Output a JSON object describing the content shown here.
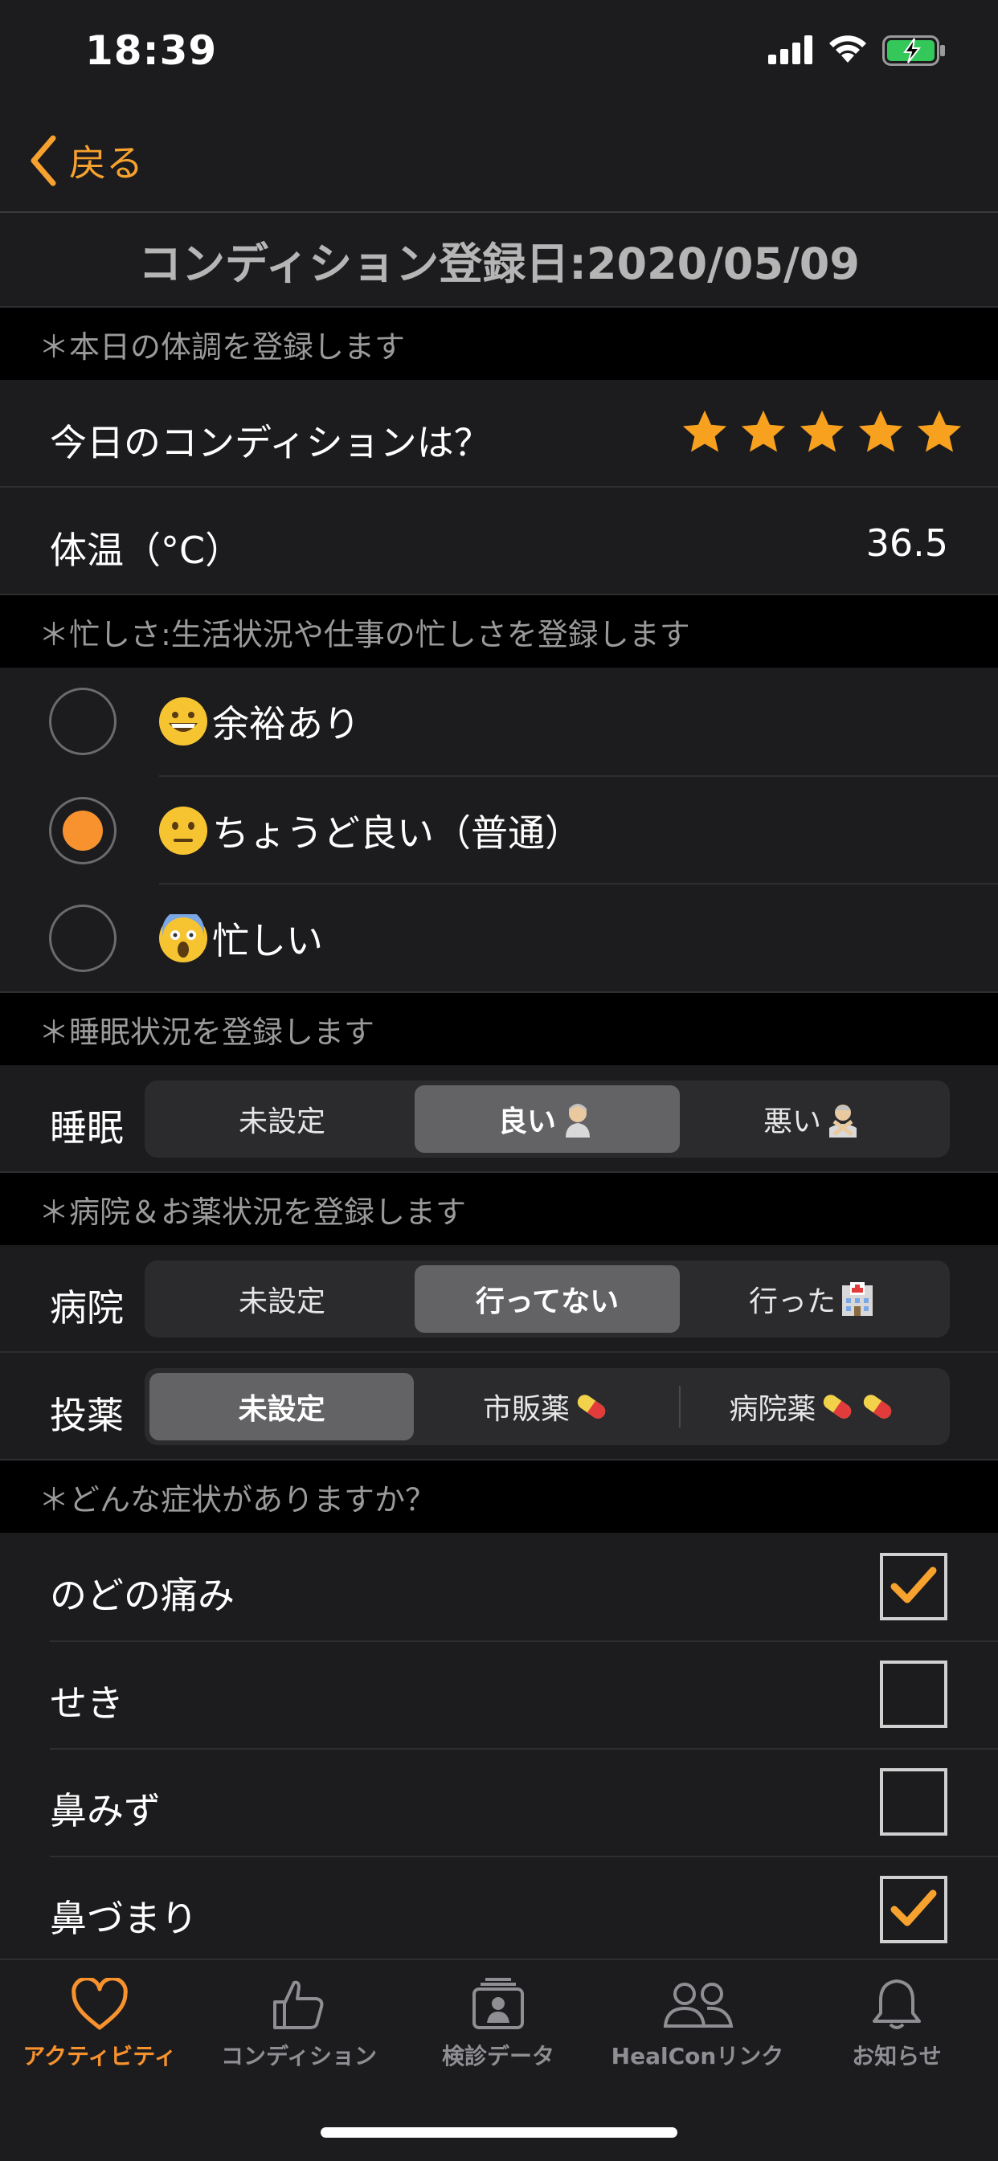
{
  "status_bar": {
    "time": "18:39"
  },
  "nav": {
    "back_label": "戻る"
  },
  "title": "コンディション登録日:2020/05/09",
  "section_condition": {
    "header": "＊本日の体調を登録します"
  },
  "condition": {
    "label": "今日のコンディションは？",
    "rating": 5,
    "max_rating": 5
  },
  "temperature": {
    "label": "体温（°C）",
    "value": "36.5"
  },
  "section_busyness": {
    "header": "＊忙しさ:生活状況や仕事の忙しさを登録します"
  },
  "busyness": {
    "options": [
      {
        "label": "余裕あり",
        "emoji": "grinning-face",
        "selected": false
      },
      {
        "label": "ちょうど良い（普通）",
        "emoji": "neutral-face",
        "selected": true
      },
      {
        "label": "忙しい",
        "emoji": "screaming-face",
        "selected": false
      }
    ]
  },
  "section_sleep": {
    "header": "＊睡眠状況を登録します"
  },
  "sleep": {
    "label": "睡眠",
    "options": [
      "未設定",
      "良い",
      "悪い"
    ],
    "selected": 1
  },
  "section_hospital": {
    "header": "＊病院＆お薬状況を登録します"
  },
  "hospital": {
    "label": "病院",
    "options": [
      "未設定",
      "行ってない",
      "行った"
    ],
    "selected": 1
  },
  "medication": {
    "label": "投薬",
    "options": [
      "未設定",
      "市販薬",
      "病院薬"
    ],
    "selected": 0
  },
  "section_symptoms": {
    "header": "＊どんな症状がありますか？"
  },
  "symptoms": [
    {
      "label": "のどの痛み",
      "checked": true
    },
    {
      "label": "せき",
      "checked": false
    },
    {
      "label": "鼻みず",
      "checked": false
    },
    {
      "label": "鼻づまり",
      "checked": true
    }
  ],
  "tabbar": {
    "tabs": [
      {
        "label": "アクティビティ",
        "icon": "heart-icon",
        "active": true
      },
      {
        "label": "コンディション",
        "icon": "thumbs-up-icon",
        "active": false
      },
      {
        "label": "検診データ",
        "icon": "id-card-icon",
        "active": false
      },
      {
        "label": "HealConリンク",
        "icon": "people-icon",
        "active": false
      },
      {
        "label": "お知らせ",
        "icon": "bell-icon",
        "active": false
      }
    ]
  },
  "colors": {
    "accent": "#f7922f",
    "star": "#f7a11f",
    "background": "#1c1c1e"
  }
}
